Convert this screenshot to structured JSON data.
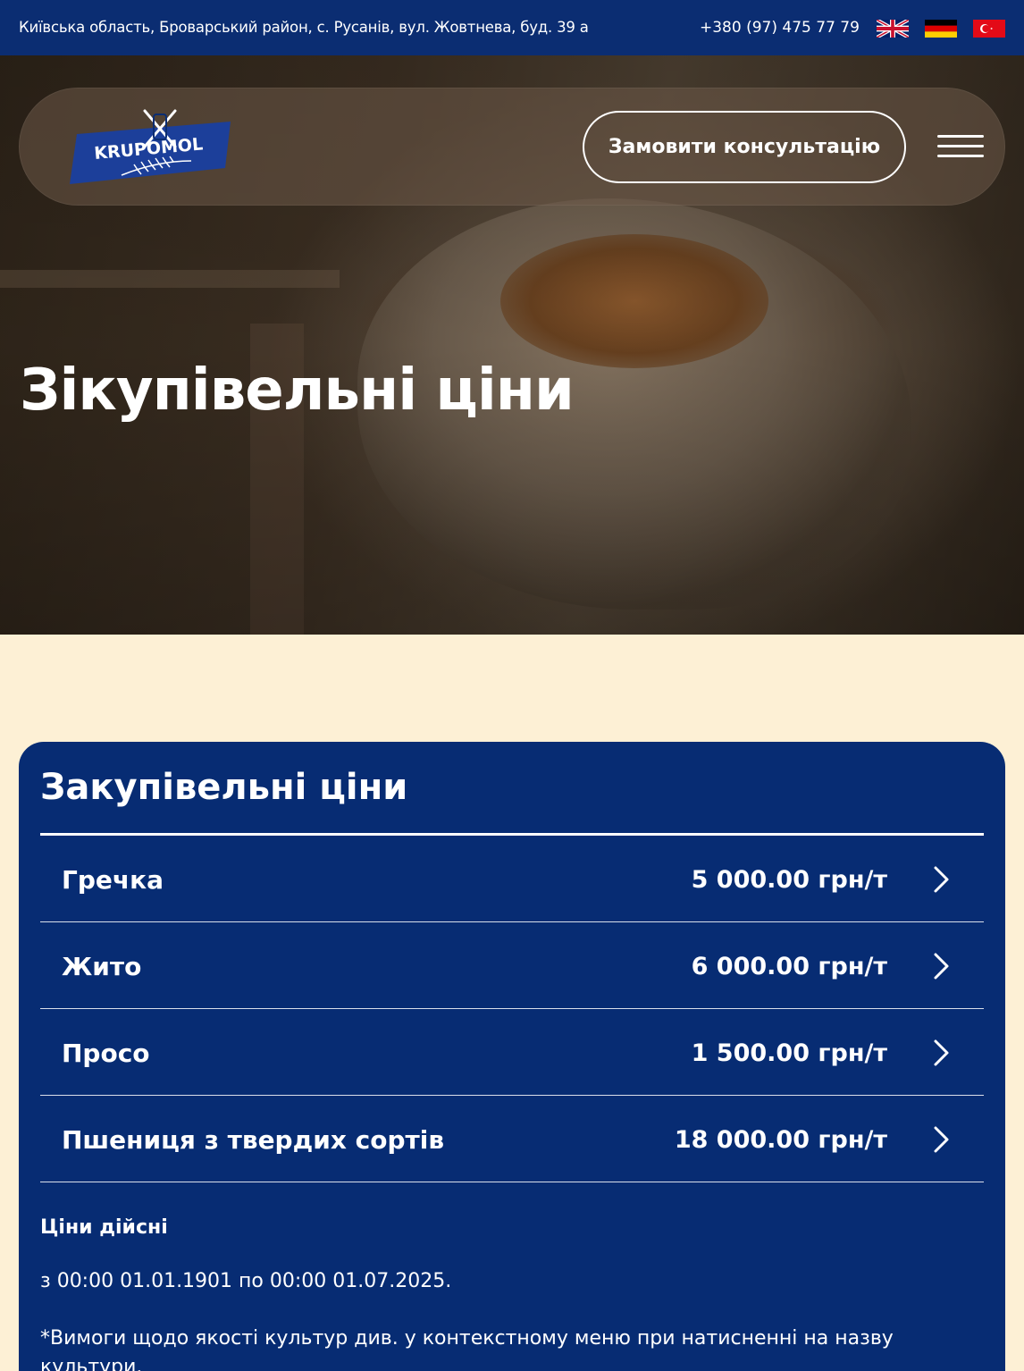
{
  "topbar": {
    "address": "Київська область, Броварський район, с. Русанів, вул. Жовтнева, буд. 39 а",
    "phone": "+380 (97) 475 77 79",
    "languages": [
      {
        "code": "en",
        "icon": "uk-flag-icon"
      },
      {
        "code": "de",
        "icon": "germany-flag-icon"
      },
      {
        "code": "tr",
        "icon": "turkey-flag-icon"
      }
    ]
  },
  "header": {
    "logo_text": "KRUPOMOL",
    "cta_label": "Замовити консультацію",
    "menu_icon": "hamburger-menu-icon"
  },
  "hero": {
    "title": "Зікупівельні ціни"
  },
  "prices": {
    "title": "Закупівельні ціни",
    "items": [
      {
        "name": "Гречка",
        "price": "5 000.00 грн/т"
      },
      {
        "name": "Жито",
        "price": "6 000.00 грн/т"
      },
      {
        "name": "Просо",
        "price": "1 500.00 грн/т"
      },
      {
        "name": "Пшениця з твердих сортів",
        "price": "18 000.00 грн/т"
      }
    ],
    "validity_heading": "Ціни дійсні",
    "validity_period": "з 00:00 01.01.1901 по 00:00 01.07.2025.",
    "requirements_note": "*Вимоги щодо якості культур див. у контекстному меню при натисненні на назву культури."
  },
  "colors": {
    "brand_blue": "#072c73",
    "topbar_blue": "#0b2d72",
    "page_background": "#fdf0d5"
  }
}
